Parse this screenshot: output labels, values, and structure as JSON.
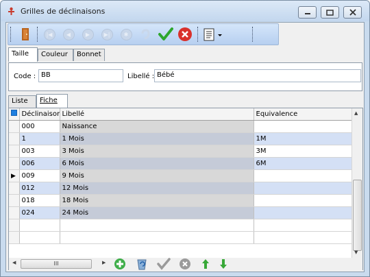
{
  "window": {
    "title": "Grilles de déclinaisons",
    "controls": {
      "minimize": "minimize",
      "maximize": "maximize",
      "close": "close"
    }
  },
  "toolbar": {
    "icons": [
      "door-exit-icon",
      "first-record-icon",
      "previous-record-icon",
      "next-record-icon",
      "last-record-icon",
      "refresh-icon",
      "undo-icon",
      "validate-check-icon",
      "cancel-x-icon",
      "report-menu-icon"
    ]
  },
  "top_tabs": [
    {
      "label": "Taille",
      "active": true
    },
    {
      "label": "Couleur",
      "active": false
    },
    {
      "label": "Bonnet",
      "active": false
    }
  ],
  "form": {
    "code_label": "Code :",
    "code_value": "BB",
    "libelle_label": "Libellé :",
    "libelle_value": "Bébé"
  },
  "bottom_tabs": [
    {
      "label": "Liste",
      "active": false
    },
    {
      "label": "Fiche",
      "active": true
    }
  ],
  "grid": {
    "columns": [
      "Déclinaisor",
      "Libellé",
      "Equivalence"
    ],
    "current_row_index": 4,
    "rows": [
      {
        "code": "000",
        "libelle": "Naissance",
        "equiv": ""
      },
      {
        "code": "1",
        "libelle": "1 Mois",
        "equiv": "1M"
      },
      {
        "code": "003",
        "libelle": "3 Mois",
        "equiv": "3M"
      },
      {
        "code": "006",
        "libelle": "6 Mois",
        "equiv": "6M"
      },
      {
        "code": "009",
        "libelle": "9 Mois",
        "equiv": ""
      },
      {
        "code": "012",
        "libelle": "12 Mois",
        "equiv": ""
      },
      {
        "code": "018",
        "libelle": "18 Mois",
        "equiv": ""
      },
      {
        "code": "024",
        "libelle": "24 Mois",
        "equiv": ""
      }
    ],
    "empty_rows": 2,
    "scrollbar_thumb_label": "III"
  },
  "grid_buttons": {
    "icons": [
      "add-row-icon",
      "delete-row-icon",
      "validate-row-icon",
      "cancel-row-icon",
      "move-up-icon",
      "move-down-icon"
    ]
  },
  "colors": {
    "row_blue": "#d4e0f5",
    "row_white": "#ffffff",
    "libelle_grey": "#d8d8d8",
    "libelle_dark": "#c5cbd8",
    "toolbar_accent": "#2da62d",
    "cancel_red": "#d9312b"
  }
}
